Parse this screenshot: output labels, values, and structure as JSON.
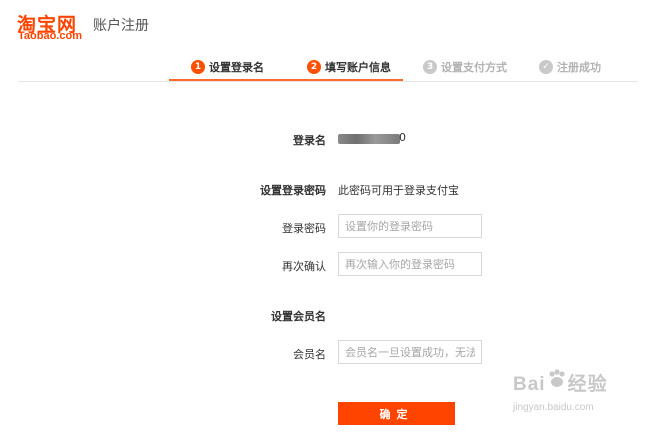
{
  "header": {
    "logo_cn": "淘宝网",
    "logo_en": "Taobao.com",
    "title": "账户注册"
  },
  "steps": [
    {
      "num": "1",
      "label": "设置登录名",
      "state": "active"
    },
    {
      "num": "2",
      "label": "填写账户信息",
      "state": "active"
    },
    {
      "num": "3",
      "label": "设置支付方式",
      "state": "inactive"
    },
    {
      "num": "✓",
      "label": "注册成功",
      "state": "inactive"
    }
  ],
  "form": {
    "login_name_label": "登录名",
    "login_name_tail": "0",
    "set_password_label": "设置登录密码",
    "set_password_note": "此密码可用于登录支付宝",
    "password_label": "登录密码",
    "password_placeholder": "设置你的登录密码",
    "confirm_label": "再次确认",
    "confirm_placeholder": "再次输入你的登录密码",
    "member_section_label": "设置会员名",
    "member_label": "会员名",
    "member_placeholder": "会员名一旦设置成功，无法修",
    "submit_label": "确定"
  },
  "watermark": {
    "main": "Bai",
    "main_suffix": "经验",
    "sub": "jingyan.baidu.com"
  },
  "colors": {
    "brand": "#ff4400",
    "active_step": "#ff4f00",
    "inactive_step": "#c9c9c9"
  }
}
